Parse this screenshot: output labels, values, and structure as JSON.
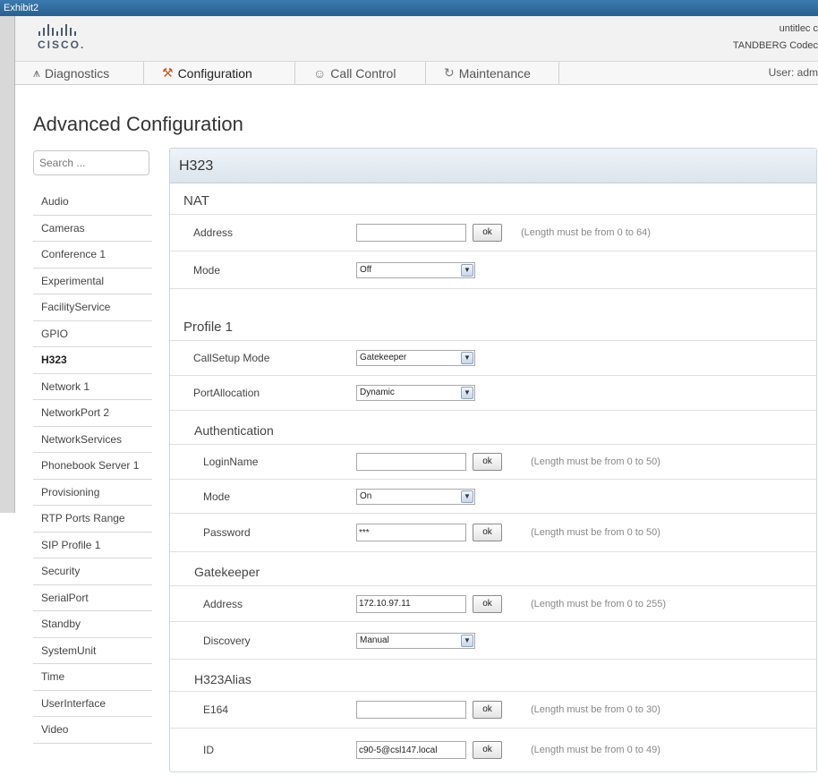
{
  "window": {
    "title": "Exhibit2"
  },
  "header": {
    "logo_text": "CISCO.",
    "device_name": "untitlec c",
    "product": "TANDBERG Codec"
  },
  "nav": {
    "tabs": [
      {
        "label": "Diagnostics",
        "icon": "pulse-icon"
      },
      {
        "label": "Configuration",
        "icon": "wrench-screwdriver-icon"
      },
      {
        "label": "Call Control",
        "icon": "people-icon"
      },
      {
        "label": "Maintenance",
        "icon": "refresh-icon"
      }
    ],
    "active_tab": "Configuration",
    "user": "User: adm"
  },
  "page": {
    "title": "Advanced Configuration"
  },
  "search": {
    "placeholder": "Search ..."
  },
  "sidebar": {
    "items": [
      {
        "label": "Audio"
      },
      {
        "label": "Cameras"
      },
      {
        "label": "Conference 1"
      },
      {
        "label": "Experimental"
      },
      {
        "label": "FacilityService"
      },
      {
        "label": "GPIO"
      },
      {
        "label": "H323"
      },
      {
        "label": "Network 1"
      },
      {
        "label": "NetworkPort 2"
      },
      {
        "label": "NetworkServices"
      },
      {
        "label": "Phonebook Server 1"
      },
      {
        "label": "Provisioning"
      },
      {
        "label": "RTP Ports Range"
      },
      {
        "label": "SIP Profile 1"
      },
      {
        "label": "Security"
      },
      {
        "label": "SerialPort"
      },
      {
        "label": "Standby"
      },
      {
        "label": "SystemUnit"
      },
      {
        "label": "Time"
      },
      {
        "label": "UserInterface"
      },
      {
        "label": "Video"
      }
    ],
    "active": "H323"
  },
  "panel": {
    "title": "H323",
    "ok_label": "ok",
    "nat": {
      "title": "NAT",
      "address": {
        "label": "Address",
        "value": "",
        "hint": "(Length must be from 0 to 64)"
      },
      "mode": {
        "label": "Mode",
        "value": "Off"
      }
    },
    "profile": {
      "title": "Profile 1",
      "callsetup_mode": {
        "label": "CallSetup Mode",
        "value": "Gatekeeper"
      },
      "port_allocation": {
        "label": "PortAllocation",
        "value": "Dynamic"
      },
      "authentication": {
        "title": "Authentication",
        "login_name": {
          "label": "LoginName",
          "value": "",
          "hint": "(Length must be from 0 to 50)"
        },
        "mode": {
          "label": "Mode",
          "value": "On"
        },
        "password": {
          "label": "Password",
          "value": "***",
          "hint": "(Length must be from 0 to 50)"
        }
      },
      "gatekeeper": {
        "title": "Gatekeeper",
        "address": {
          "label": "Address",
          "value": "172.10.97.11",
          "hint": "(Length must be from 0 to 255)"
        },
        "discovery": {
          "label": "Discovery",
          "value": "Manual"
        }
      },
      "h323alias": {
        "title": "H323Alias",
        "e164": {
          "label": "E164",
          "value": "",
          "hint": "(Length must be from 0 to 30)"
        },
        "id": {
          "label": "ID",
          "value": "c90-5@csl147.local",
          "hint": "(Length must be from 0 to 49)"
        }
      }
    }
  }
}
